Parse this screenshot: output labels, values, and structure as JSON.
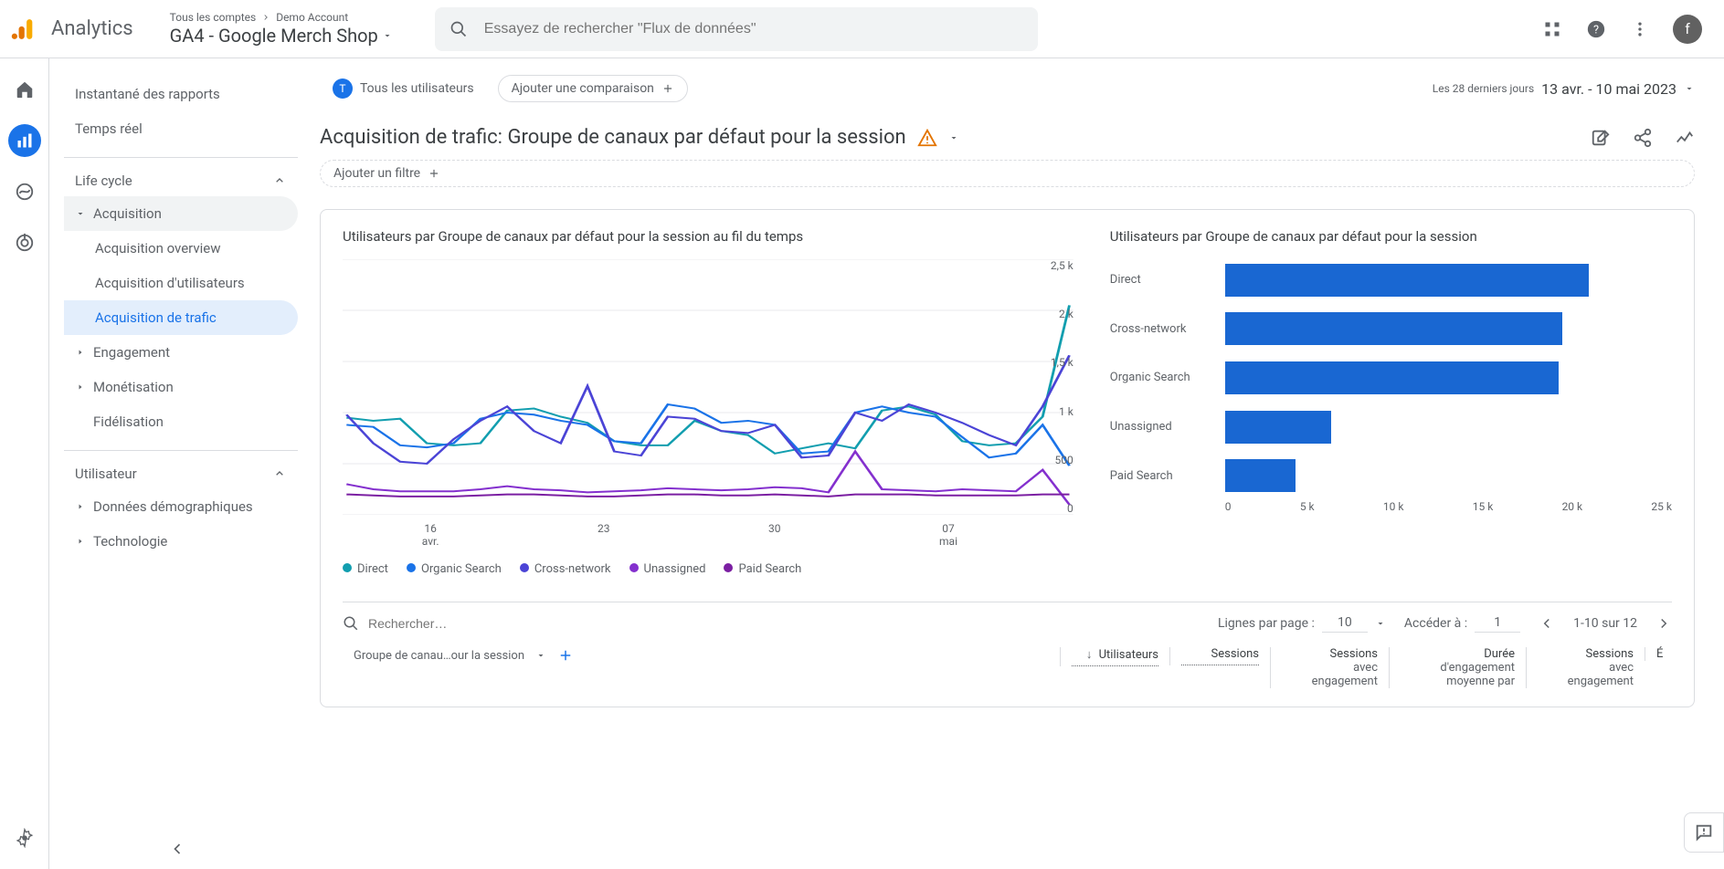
{
  "header": {
    "product": "Analytics",
    "breadcrumb_all": "Tous les comptes",
    "breadcrumb_account": "Demo Account",
    "property": "GA4 - Google Merch Shop",
    "search_placeholder": "Essayez de rechercher \"Flux de données\"",
    "avatar_initial": "f"
  },
  "sidebar": {
    "snapshot": "Instantané des rapports",
    "realtime": "Temps réel",
    "section_lifecycle": "Life cycle",
    "acquisition": "Acquisition",
    "acq_overview": "Acquisition overview",
    "acq_users": "Acquisition d'utilisateurs",
    "acq_traffic": "Acquisition de trafic",
    "engagement": "Engagement",
    "monetisation": "Monétisation",
    "fidelisation": "Fidélisation",
    "section_user": "Utilisateur",
    "demographics": "Données démographiques",
    "technology": "Technologie"
  },
  "filters": {
    "all_users": "Tous les utilisateurs",
    "add_comparison": "Ajouter une comparaison",
    "date_range_label": "Les 28 derniers jours",
    "date_range": "13 avr. - 10 mai 2023",
    "page_title": "Acquisition de trafic: Groupe de canaux par défaut pour la session",
    "add_filter": "Ajouter un filtre"
  },
  "charts": {
    "line_title": "Utilisateurs par Groupe de canaux par défaut pour la session au fil du temps",
    "bar_title": "Utilisateurs par Groupe de canaux par défaut pour la session"
  },
  "chart_data": [
    {
      "type": "line",
      "title": "Utilisateurs par Groupe de canaux par défaut pour la session au fil du temps",
      "ylabel": "",
      "ylim": [
        0,
        2500
      ],
      "y_ticks": [
        "2,5 k",
        "2 k",
        "1,5 k",
        "1 k",
        "500",
        "0"
      ],
      "x_ticks": [
        {
          "top": "16",
          "bottom": "avr."
        },
        {
          "top": "23",
          "bottom": ""
        },
        {
          "top": "30",
          "bottom": ""
        },
        {
          "top": "07",
          "bottom": "mai"
        }
      ],
      "legend": [
        {
          "name": "Direct",
          "color": "#129eaf"
        },
        {
          "name": "Organic Search",
          "color": "#1a73e8"
        },
        {
          "name": "Cross-network",
          "color": "#4b44d6"
        },
        {
          "name": "Unassigned",
          "color": "#8430ce"
        },
        {
          "name": "Paid Search",
          "color": "#7b1fa2"
        }
      ],
      "series": [
        {
          "name": "Direct",
          "color": "#129eaf",
          "values": [
            950,
            920,
            940,
            700,
            680,
            700,
            1020,
            1040,
            960,
            900,
            720,
            680,
            680,
            920,
            820,
            780,
            600,
            650,
            700,
            650,
            1020,
            1060,
            980,
            720,
            680,
            700,
            960,
            2050
          ]
        },
        {
          "name": "Organic Search",
          "color": "#1a73e8",
          "values": [
            880,
            860,
            680,
            660,
            700,
            940,
            1000,
            980,
            920,
            880,
            720,
            700,
            1080,
            1040,
            900,
            920,
            880,
            600,
            620,
            1000,
            1060,
            1000,
            960,
            760,
            560,
            600,
            880,
            480
          ]
        },
        {
          "name": "Cross-network",
          "color": "#4b44d6",
          "values": [
            980,
            700,
            520,
            500,
            740,
            920,
            1060,
            820,
            700,
            1260,
            620,
            580,
            960,
            940,
            820,
            800,
            880,
            560,
            580,
            1000,
            920,
            1080,
            1000,
            900,
            780,
            680,
            1060,
            1560
          ]
        },
        {
          "name": "Unassigned",
          "color": "#8430ce",
          "values": [
            300,
            250,
            230,
            230,
            230,
            250,
            280,
            250,
            240,
            220,
            230,
            240,
            260,
            250,
            240,
            250,
            270,
            260,
            220,
            620,
            250,
            240,
            230,
            250,
            240,
            230,
            440,
            100
          ]
        },
        {
          "name": "Paid Search",
          "color": "#7b1fa2",
          "values": [
            200,
            190,
            180,
            180,
            180,
            190,
            200,
            200,
            190,
            180,
            180,
            190,
            200,
            200,
            190,
            190,
            200,
            190,
            180,
            200,
            200,
            200,
            190,
            190,
            190,
            190,
            200,
            200
          ]
        }
      ]
    },
    {
      "type": "bar",
      "title": "Utilisateurs par Groupe de canaux par défaut pour la session",
      "xlim": [
        0,
        25000
      ],
      "x_ticks": [
        "0",
        "5 k",
        "10 k",
        "15 k",
        "20 k",
        "25 k"
      ],
      "categories": [
        "Direct",
        "Cross-network",
        "Organic Search",
        "Unassigned",
        "Paid Search"
      ],
      "values": [
        20500,
        19000,
        18800,
        6000,
        4000
      ]
    }
  ],
  "table": {
    "search_placeholder": "Rechercher…",
    "rows_per_page_label": "Lignes par page :",
    "rows_per_page": "10",
    "goto_label": "Accéder à :",
    "goto_value": "1",
    "range": "1-10 sur 12",
    "dim_header": "Groupe de canau…our la session",
    "col_users": "Utilisateurs",
    "col_sessions": "Sessions",
    "col_eng_sessions_l1": "Sessions",
    "col_eng_sessions_l2": "avec",
    "col_eng_sessions_l3": "engagement",
    "col_avg_l1": "Durée",
    "col_avg_l2": "d'engagement",
    "col_avg_l3": "moyenne par",
    "col_eng2_l1": "Sessions",
    "col_eng2_l2": "avec",
    "col_eng2_l3": "engagement",
    "col_extra": "É"
  }
}
